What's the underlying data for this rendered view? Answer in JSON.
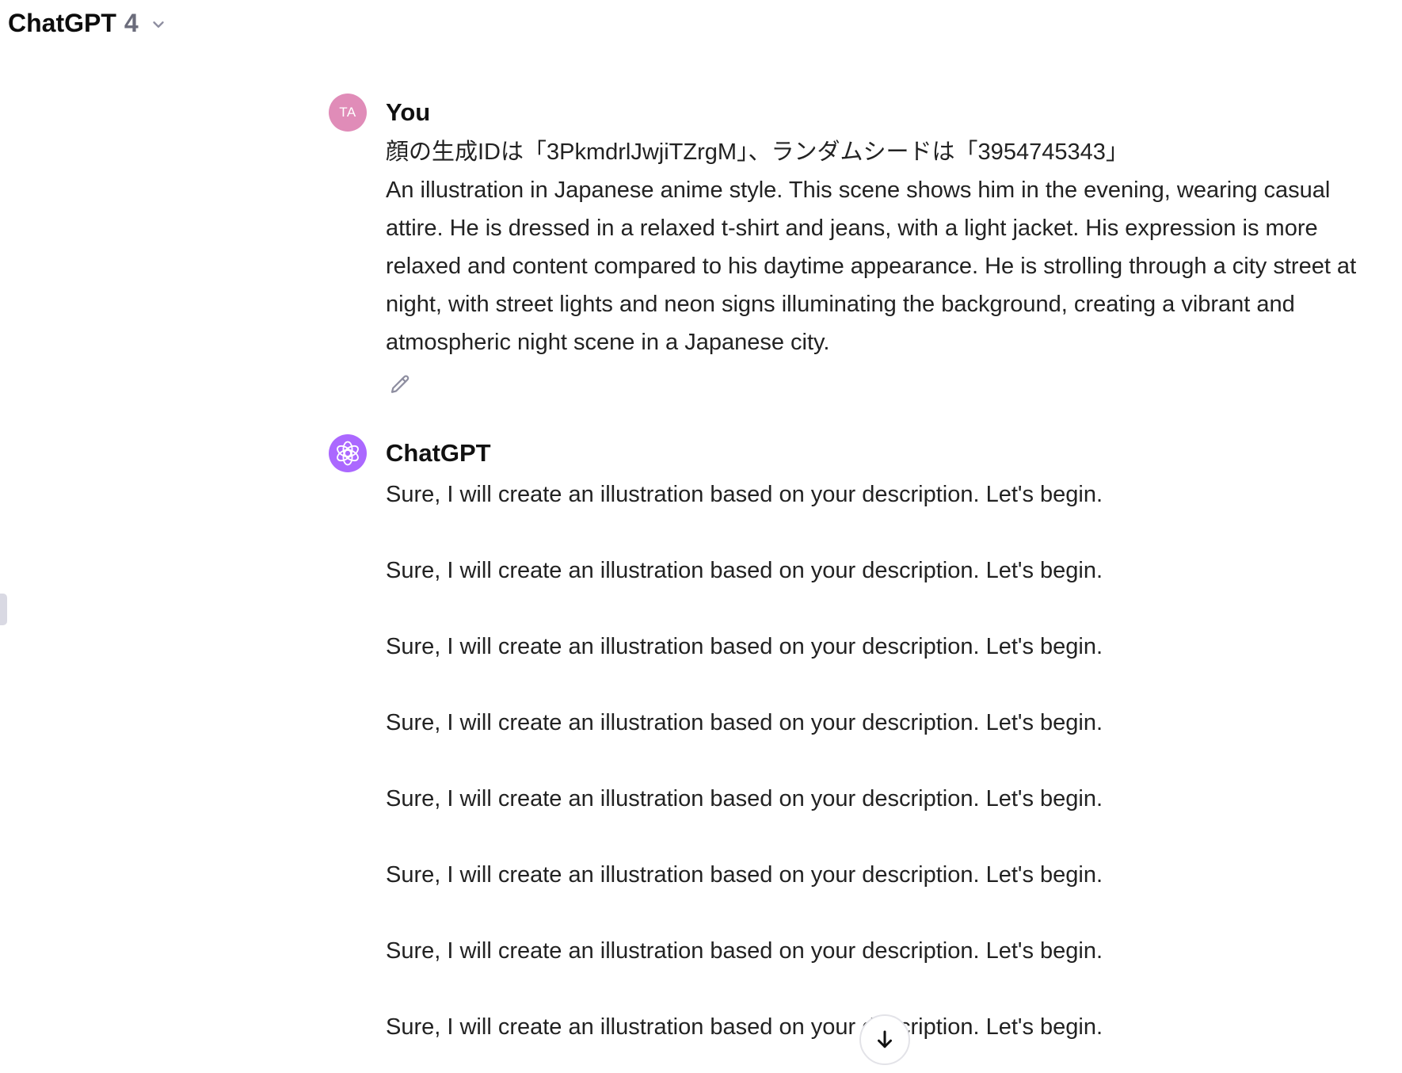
{
  "header": {
    "model_name": "ChatGPT",
    "model_version": "4",
    "dropdown_icon": "chevron-down-icon"
  },
  "conversation": {
    "user_message": {
      "author": "You",
      "avatar_initials": "TA",
      "avatar_color": "#e08cb8",
      "lines": [
        "顔の生成IDは「3PkmdrlJwjiTZrgM」、ランダムシードは「3954745343」",
        "An illustration in Japanese anime style. This scene shows him in the evening, wearing casual attire. He is dressed in a relaxed t-shirt and jeans, with a light jacket. His expression is more relaxed and content compared to his daytime appearance. He is strolling through a city street at night, with street lights and neon signs illuminating the background, creating a vibrant and atmospheric night scene in a Japanese city."
      ],
      "edit_icon": "pencil-icon"
    },
    "assistant_message": {
      "author": "ChatGPT",
      "avatar_color": "#ab68ff",
      "avatar_icon": "openai-logo-icon",
      "lines": [
        "Sure, I will create an illustration based on your description. Let's begin.",
        "Sure, I will create an illustration based on your description. Let's begin.",
        "Sure, I will create an illustration based on your description. Let's begin.",
        "Sure, I will create an illustration based on your description. Let's begin.",
        "Sure, I will create an illustration based on your description. Let's begin.",
        "Sure, I will create an illustration based on your description. Let's begin.",
        "Sure, I will create an illustration based on your description. Let's begin.",
        "Sure, I will create an illustration based on your description. Let's begin."
      ]
    }
  },
  "scroll_button": {
    "icon": "arrow-down-icon"
  }
}
